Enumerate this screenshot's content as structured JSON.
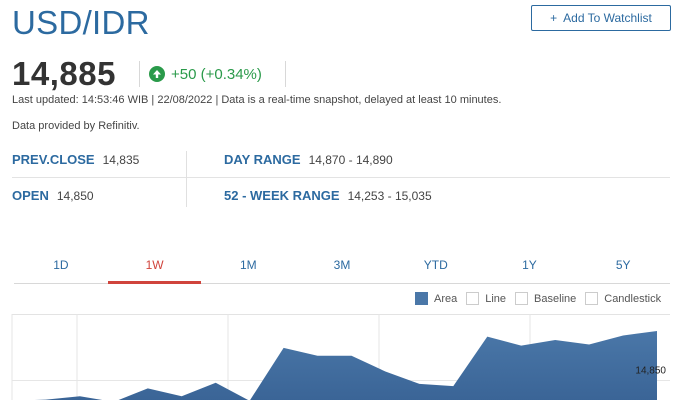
{
  "header": {
    "title": "USD/IDR",
    "watchlist_label": "Add To Watchlist"
  },
  "quote": {
    "price": "14,885",
    "change": "+50 (+0.34%)",
    "last_updated": "Last updated: 14:53:46 WIB | 22/08/2022 | Data is a real-time snapshot, delayed at least 10 minutes.",
    "provider": "Data provided by Refinitiv."
  },
  "stats": {
    "prev_close_label": "PREV.CLOSE",
    "prev_close_value": "14,835",
    "day_range_label": "DAY RANGE",
    "day_range_value": "14,870 - 14,890",
    "open_label": "OPEN",
    "open_value": "14,850",
    "week52_label": "52 - WEEK RANGE",
    "week52_value": "14,253 - 15,035"
  },
  "tabs": [
    "1D",
    "1W",
    "1M",
    "3M",
    "YTD",
    "1Y",
    "5Y"
  ],
  "active_tab": "1W",
  "legend": [
    {
      "label": "Area",
      "checked": true
    },
    {
      "label": "Line",
      "checked": false
    },
    {
      "label": "Baseline",
      "checked": false
    },
    {
      "label": "Candlestick",
      "checked": false
    }
  ],
  "colors": {
    "accent": "#2c6aa0",
    "positive": "#2a9a4a",
    "active_tab": "#d0443c",
    "area_fill": "#4a77a8"
  },
  "chart_data": {
    "type": "area",
    "y_tick_labels": [
      "14,850"
    ],
    "ylim": [
      14820,
      14900
    ],
    "values": [
      14822,
      14823,
      14826,
      14821,
      14833,
      14826,
      14838,
      14822,
      14869,
      14862,
      14862,
      14848,
      14837,
      14835,
      14879,
      14871,
      14876,
      14872,
      14880,
      14884
    ]
  }
}
